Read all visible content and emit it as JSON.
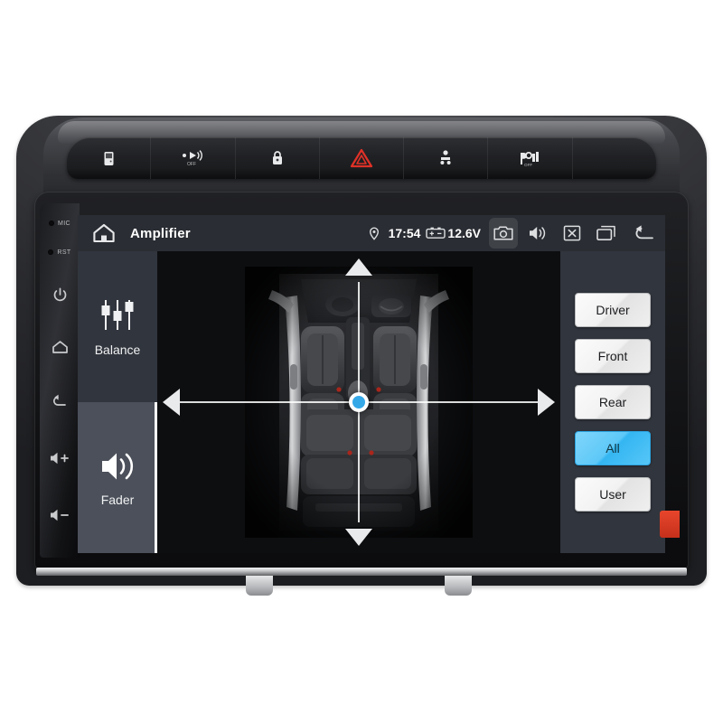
{
  "device": {
    "dashboard_keys": [
      {
        "name": "door-lock-button",
        "icon": "door-icon"
      },
      {
        "name": "parking-sensor-button",
        "icon": "parking-sensor-icon"
      },
      {
        "name": "central-lock-button",
        "icon": "lock-icon"
      },
      {
        "name": "hazard-lights-button",
        "icon": "hazard-triangle-icon",
        "color": "#e03127"
      },
      {
        "name": "airbag-button",
        "icon": "airbag-icon"
      },
      {
        "name": "child-lock-button",
        "icon": "child-lock-icon"
      },
      {
        "name": "blank-key",
        "icon": "blank-icon"
      }
    ],
    "hard_keys": [
      {
        "name": "mic-indicator",
        "label": "MIC"
      },
      {
        "name": "reset-indicator",
        "label": "RST"
      },
      {
        "name": "power-button",
        "icon": "power-icon"
      },
      {
        "name": "home-button",
        "icon": "home-icon"
      },
      {
        "name": "back-button",
        "icon": "back-arrow-icon"
      },
      {
        "name": "volume-up-button",
        "icon": "volume-up-icon"
      },
      {
        "name": "volume-down-button",
        "icon": "volume-down-icon"
      }
    ]
  },
  "header": {
    "home_icon": "home-icon",
    "title": "Amplifier",
    "status": {
      "location_icon": "location-pin-icon",
      "time": "17:54",
      "battery_icon": "battery-icon",
      "voltage": "12.6V",
      "camera_icon": "camera-icon",
      "volume_icon": "speaker-icon",
      "close_icon": "close-box-icon",
      "recents_icon": "recent-apps-icon",
      "back_icon": "back-arrow-icon"
    }
  },
  "sidebar": {
    "items": [
      {
        "label": "Balance",
        "icon": "balance-sliders-icon",
        "active": false
      },
      {
        "label": "Fader",
        "icon": "speaker-waves-icon",
        "active": true
      }
    ]
  },
  "main": {
    "car_diagram": {
      "name": "car-interior-top-view",
      "arrows": [
        {
          "name": "arrow-up",
          "direction": "up"
        },
        {
          "name": "arrow-down",
          "direction": "down"
        },
        {
          "name": "arrow-left",
          "direction": "left"
        },
        {
          "name": "arrow-right",
          "direction": "right"
        }
      ],
      "center_point": {
        "name": "balance-fader-position-dot",
        "color": "#35a8e8"
      }
    }
  },
  "presets": {
    "selected": "All",
    "accent_color": "#4cc2f5",
    "items": [
      {
        "label": "Driver",
        "selected": false
      },
      {
        "label": "Front",
        "selected": false
      },
      {
        "label": "Rear",
        "selected": false
      },
      {
        "label": "All",
        "selected": true
      },
      {
        "label": "User",
        "selected": false
      }
    ]
  }
}
